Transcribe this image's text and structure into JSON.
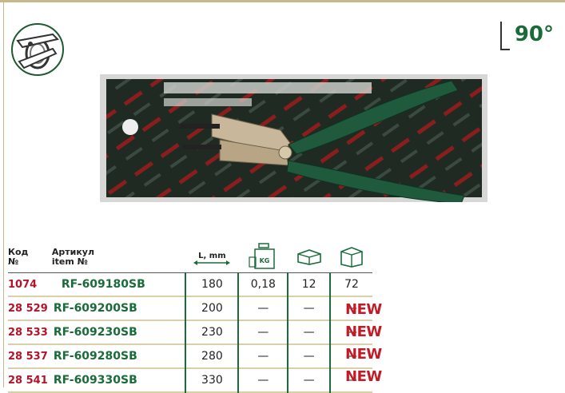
{
  "badge": {
    "angle": "90°"
  },
  "table": {
    "header": {
      "code_label": "Код",
      "code_label2": "№",
      "article_label": "Артикул",
      "article_label2": "item №",
      "length_label": "L, mm",
      "weight_icon": "scale-kg-icon",
      "weight_icon_text": "KG",
      "inner_box_icon": "inner-box-icon",
      "outer_box_icon": "outer-box-icon"
    },
    "rows": [
      {
        "code": "1074",
        "article": "RF-609180SB",
        "length": "180",
        "weight": "0,18",
        "inner": "12",
        "outer": "72",
        "new": ""
      },
      {
        "code": "28 529",
        "article": "RF-609200SB",
        "length": "200",
        "weight": "—",
        "inner": "—",
        "outer": "—",
        "new": "NEW"
      },
      {
        "code": "28 533",
        "article": "RF-609230SB",
        "length": "230",
        "weight": "—",
        "inner": "—",
        "outer": "—",
        "new": "NEW"
      },
      {
        "code": "28 537",
        "article": "RF-609280SB",
        "length": "280",
        "weight": "—",
        "inner": "—",
        "outer": "—",
        "new": "NEW"
      },
      {
        "code": "28 541",
        "article": "RF-609330SB",
        "length": "330",
        "weight": "—",
        "inner": "—",
        "outer": "—",
        "new": "NEW"
      }
    ]
  },
  "colors": {
    "green": "#1b6b3a",
    "red": "#b3142a",
    "new_red": "#c41a26",
    "rule": "#c9b78c"
  }
}
